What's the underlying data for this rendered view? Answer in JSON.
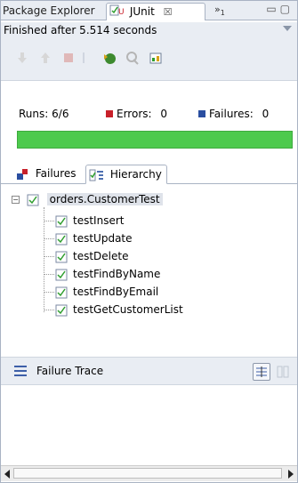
{
  "tabs": {
    "package_explorer": "Package Explorer",
    "junit": "JUnit",
    "junit_close": "☒",
    "overflow": "»",
    "overflow_count": "1"
  },
  "status": {
    "text": "Finished after 5.514 seconds"
  },
  "counters": {
    "runs_label": "Runs:",
    "runs_value": "6/6",
    "errors_label": "Errors:",
    "errors_value": "0",
    "failures_label": "Failures:",
    "failures_value": "0"
  },
  "progress": {
    "fraction": 1.0,
    "color": "#4dca4d"
  },
  "subtabs": {
    "failures": "Failures",
    "hierarchy": "Hierarchy"
  },
  "tree": {
    "root": "orders.CustomerTest",
    "tests": [
      "testInsert",
      "testUpdate",
      "testDelete",
      "testFindByName",
      "testFindByEmail",
      "testGetCustomerList"
    ]
  },
  "trace": {
    "label": "Failure Trace"
  },
  "colors": {
    "accent": "#4dca4d",
    "error": "#c8202a",
    "failure": "#2a4ea0"
  }
}
